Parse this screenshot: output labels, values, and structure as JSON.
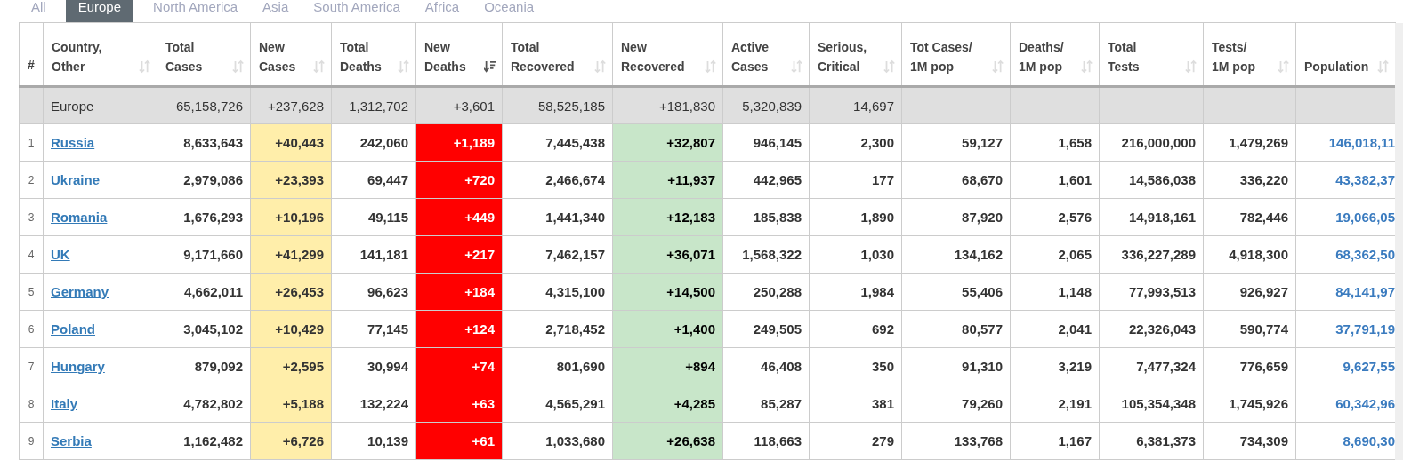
{
  "tabs": [
    {
      "label": "All",
      "selected": false
    },
    {
      "label": "Europe",
      "selected": true
    },
    {
      "label": "North America",
      "selected": false
    },
    {
      "label": "Asia",
      "selected": false
    },
    {
      "label": "South America",
      "selected": false
    },
    {
      "label": "Africa",
      "selected": false
    },
    {
      "label": "Oceania",
      "selected": false
    }
  ],
  "table": {
    "columns": [
      {
        "label_lines": [
          "#"
        ],
        "kind": "index",
        "sortable": false
      },
      {
        "label_lines": [
          "Country,",
          "Other"
        ],
        "kind": "country",
        "sortable": true,
        "sorted": false
      },
      {
        "label_lines": [
          "Total",
          "Cases"
        ],
        "kind": "number",
        "sortable": true,
        "sorted": false
      },
      {
        "label_lines": [
          "New",
          "Cases"
        ],
        "kind": "new_cases",
        "sortable": true,
        "sorted": false
      },
      {
        "label_lines": [
          "Total",
          "Deaths"
        ],
        "kind": "number",
        "sortable": true,
        "sorted": false
      },
      {
        "label_lines": [
          "New",
          "Deaths"
        ],
        "kind": "new_deaths",
        "sortable": true,
        "sorted": true
      },
      {
        "label_lines": [
          "Total",
          "Recovered"
        ],
        "kind": "number",
        "sortable": true,
        "sorted": false
      },
      {
        "label_lines": [
          "New",
          "Recovered"
        ],
        "kind": "new_recovered",
        "sortable": true,
        "sorted": false
      },
      {
        "label_lines": [
          "Active",
          "Cases"
        ],
        "kind": "number",
        "sortable": true,
        "sorted": false
      },
      {
        "label_lines": [
          "Serious,",
          "Critical"
        ],
        "kind": "number",
        "sortable": true,
        "sorted": false
      },
      {
        "label_lines": [
          "Tot Cases/",
          "1M pop"
        ],
        "kind": "number",
        "sortable": true,
        "sorted": false
      },
      {
        "label_lines": [
          "Deaths/",
          "1M pop"
        ],
        "kind": "number",
        "sortable": true,
        "sorted": false
      },
      {
        "label_lines": [
          "Total",
          "Tests"
        ],
        "kind": "number",
        "sortable": true,
        "sorted": false
      },
      {
        "label_lines": [
          "Tests/",
          "1M pop"
        ],
        "kind": "number",
        "sortable": true,
        "sorted": false
      },
      {
        "label_lines": [
          "Population"
        ],
        "kind": "population",
        "sortable": true,
        "sorted": false
      }
    ],
    "summary": {
      "label": "Europe",
      "values": [
        "65,158,726",
        "+237,628",
        "1,312,702",
        "+3,601",
        "58,525,185",
        "+181,830",
        "5,320,839",
        "14,697"
      ]
    },
    "rows": [
      [
        "1",
        "Russia",
        "8,633,643",
        "+40,443",
        "242,060",
        "+1,189",
        "7,445,438",
        "+32,807",
        "946,145",
        "2,300",
        "59,127",
        "1,658",
        "216,000,000",
        "1,479,269",
        "146,018,11"
      ],
      [
        "2",
        "Ukraine",
        "2,979,086",
        "+23,393",
        "69,447",
        "+720",
        "2,466,674",
        "+11,937",
        "442,965",
        "177",
        "68,670",
        "1,601",
        "14,586,038",
        "336,220",
        "43,382,37"
      ],
      [
        "3",
        "Romania",
        "1,676,293",
        "+10,196",
        "49,115",
        "+449",
        "1,441,340",
        "+12,183",
        "185,838",
        "1,890",
        "87,920",
        "2,576",
        "14,918,161",
        "782,446",
        "19,066,05"
      ],
      [
        "4",
        "UK",
        "9,171,660",
        "+41,299",
        "141,181",
        "+217",
        "7,462,157",
        "+36,071",
        "1,568,322",
        "1,030",
        "134,162",
        "2,065",
        "336,227,289",
        "4,918,300",
        "68,362,50"
      ],
      [
        "5",
        "Germany",
        "4,662,011",
        "+26,453",
        "96,623",
        "+184",
        "4,315,100",
        "+14,500",
        "250,288",
        "1,984",
        "55,406",
        "1,148",
        "77,993,513",
        "926,927",
        "84,141,97"
      ],
      [
        "6",
        "Poland",
        "3,045,102",
        "+10,429",
        "77,145",
        "+124",
        "2,718,452",
        "+1,400",
        "249,505",
        "692",
        "80,577",
        "2,041",
        "22,326,043",
        "590,774",
        "37,791,19"
      ],
      [
        "7",
        "Hungary",
        "879,092",
        "+2,595",
        "30,994",
        "+74",
        "801,690",
        "+894",
        "46,408",
        "350",
        "91,310",
        "3,219",
        "7,477,324",
        "776,659",
        "9,627,55"
      ],
      [
        "8",
        "Italy",
        "4,782,802",
        "+5,188",
        "132,224",
        "+63",
        "4,565,291",
        "+4,285",
        "85,287",
        "381",
        "79,260",
        "2,191",
        "105,354,348",
        "1,745,926",
        "60,342,96"
      ],
      [
        "9",
        "Serbia",
        "1,162,482",
        "+6,726",
        "10,139",
        "+61",
        "1,033,680",
        "+26,638",
        "118,663",
        "279",
        "133,768",
        "1,167",
        "6,381,373",
        "734,309",
        "8,690,30"
      ]
    ]
  }
}
